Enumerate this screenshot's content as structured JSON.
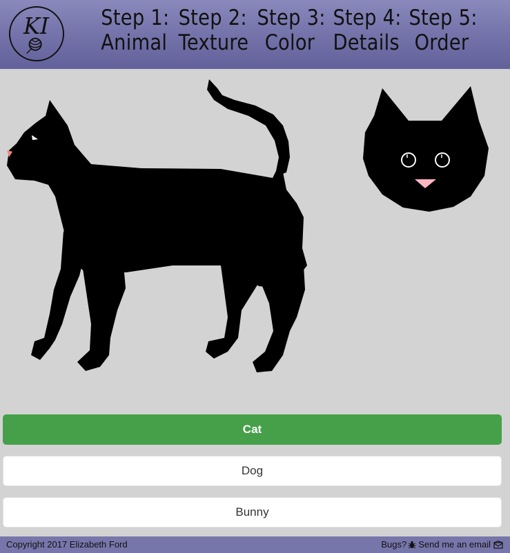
{
  "header": {
    "logo_name": "knitting-yarn-logo",
    "logo_text": "KI",
    "steps": [
      {
        "number": "Step 1:",
        "label": "Animal"
      },
      {
        "number": "Step 2:",
        "label": "Texture"
      },
      {
        "number": "Step 3:",
        "label": "Color"
      },
      {
        "number": "Step 4:",
        "label": "Details"
      },
      {
        "number": "Step 5:",
        "label": "Order"
      }
    ]
  },
  "preview": {
    "body_icon": "cat-body-silhouette",
    "face_icon": "cat-face",
    "fur_color": "#000000",
    "nose_color": "#ffb6c1"
  },
  "options": [
    {
      "label": "Cat",
      "selected": true
    },
    {
      "label": "Dog",
      "selected": false
    },
    {
      "label": "Bunny",
      "selected": false
    }
  ],
  "colors": {
    "header_bg": "#7473aa",
    "selected_bg": "#45a049",
    "page_bg": "#d3d3d3"
  },
  "footer": {
    "copyright": "Copyright 2017 Elizabeth Ford",
    "bugs_label": "Bugs?",
    "bug_icon": "bug-icon",
    "email_label": "Send me an email",
    "email_icon": "envelope-icon"
  }
}
